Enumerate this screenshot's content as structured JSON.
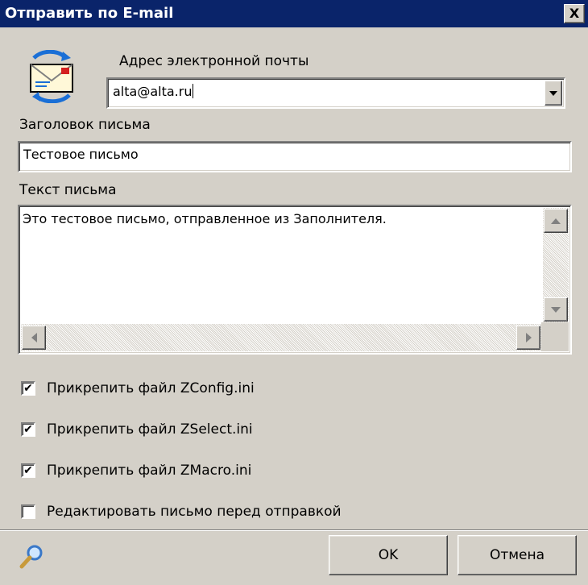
{
  "window": {
    "title": "Отправить по E-mail",
    "close_label": "X"
  },
  "icons": {
    "header": "envelope-mail-icon",
    "close": "close-icon",
    "footer": "magnifier-icon"
  },
  "address": {
    "label": "Адрес электронной почты",
    "value": "alta@alta.ru"
  },
  "subject": {
    "label": "Заголовок письма",
    "value": "Тестовое письмо"
  },
  "body": {
    "label": "Текст письма",
    "value": "Это тестовое письмо, отправленное из Заполнителя."
  },
  "checkboxes": [
    {
      "label": "Прикрепить файл ZConfig.ini",
      "checked": true
    },
    {
      "label": "Прикрепить файл ZSelect.ini",
      "checked": true
    },
    {
      "label": "Прикрепить файл ZMacro.ini",
      "checked": true
    },
    {
      "label": "Редактировать письмо перед отправкой",
      "checked": false
    }
  ],
  "buttons": {
    "ok_label": "OK",
    "cancel_label": "Отмена"
  },
  "colors": {
    "titlebar": "#0a246a",
    "dialog_bg": "#d4d0c8",
    "field_bg": "#ffffff"
  }
}
